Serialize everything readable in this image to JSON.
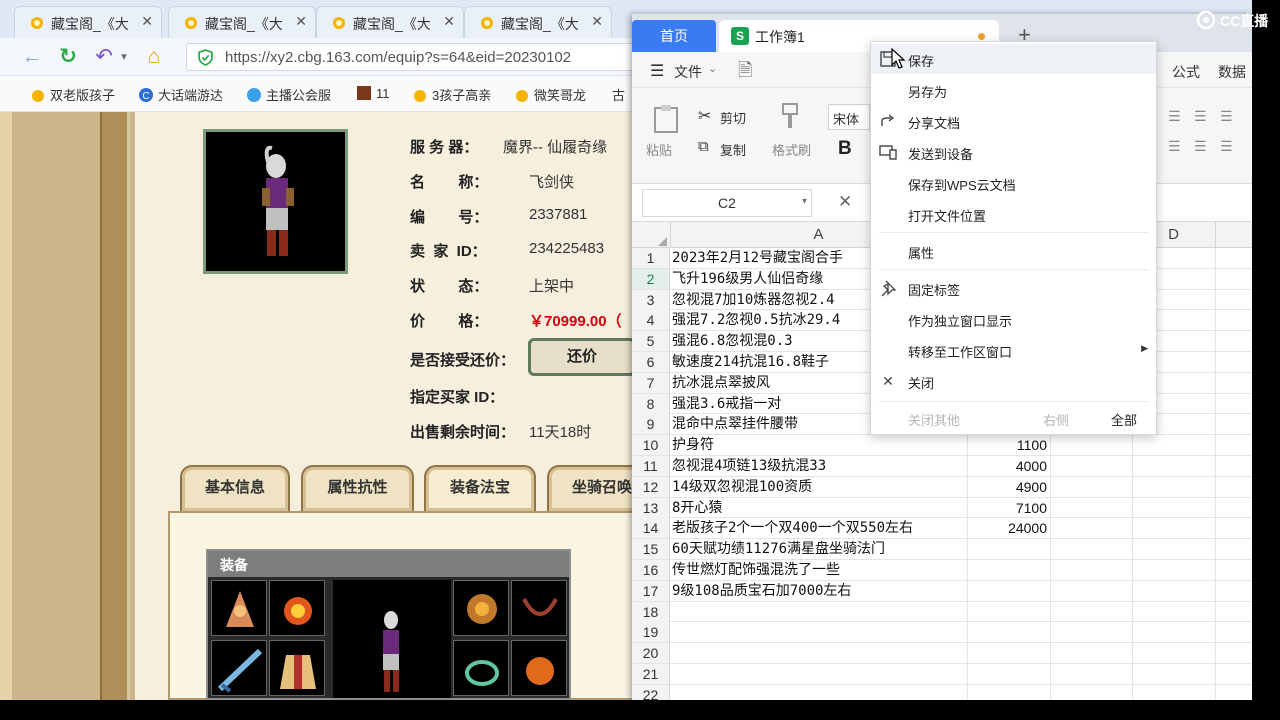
{
  "browser": {
    "tabs": [
      {
        "title": "藏宝阁_《大"
      },
      {
        "title": "藏宝阁_《大"
      },
      {
        "title": "藏宝阁_《大"
      },
      {
        "title": "藏宝阁_《大"
      }
    ],
    "url": "https://xy2.cbg.163.com/equip?s=64&eid=20230102",
    "bookmarks": [
      "双老版孩子",
      "大话端游达",
      "主播公会服",
      "11",
      "3孩子高亲",
      "微笑哥龙",
      "古"
    ]
  },
  "listing": {
    "labels": {
      "server": "服 务 器：",
      "name": "名        称：",
      "id": "编        号：",
      "seller": "卖  家  ID：",
      "status": "状        态：",
      "price": "价        格：",
      "counter_offer": "是否接受还价：",
      "buyer_id": "指定买家 ID：",
      "remaining": "出售剩余时间："
    },
    "server": "魔界-- 仙履奇缘",
    "name": "飞剑侠",
    "id": "2337881",
    "seller_id": "234225483",
    "status": "上架中",
    "price": "￥70999.00（",
    "remaining_time": "11天18时",
    "counter_button": "还价",
    "tabs": [
      "基本信息",
      "属性抗性",
      "装备法宝",
      "坐骑召唤"
    ],
    "equip_title": "装备"
  },
  "wps": {
    "home_tab": "首页",
    "doc_tab": "工作簿1",
    "doc_icon": "S",
    "menu": {
      "file": "文件",
      "formula": "公式",
      "data": "数据"
    },
    "ribbon": {
      "paste": "粘贴",
      "cut": "剪切",
      "copy": "复制",
      "format_painter": "格式刷",
      "font": "宋体",
      "bold": "B"
    },
    "name_box": "C2",
    "columns": [
      "A",
      "D"
    ],
    "rows": [
      {
        "n": "1",
        "a": "2023年2月12号藏宝阁合手",
        "b": ""
      },
      {
        "n": "2",
        "a": "飞升196级男人仙侣奇缘",
        "b": ""
      },
      {
        "n": "3",
        "a": "忽视混7加10炼器忽视2.4",
        "b": ""
      },
      {
        "n": "4",
        "a": "强混7.2忽视0.5抗冰29.4",
        "b": ""
      },
      {
        "n": "5",
        "a": "强混6.8忽视混0.3",
        "b": ""
      },
      {
        "n": "6",
        "a": "敏速度214抗混16.8鞋子",
        "b": ""
      },
      {
        "n": "7",
        "a": "抗冰混点翠披风",
        "b": ""
      },
      {
        "n": "8",
        "a": "强混3.6戒指一对",
        "b": ""
      },
      {
        "n": "9",
        "a": "混命中点翠挂件腰带",
        "b": ""
      },
      {
        "n": "10",
        "a": "护身符",
        "b": "1100"
      },
      {
        "n": "11",
        "a": "忽视混4项链13级抗混33",
        "b": "4000"
      },
      {
        "n": "12",
        "a": "14级双忽视混100资质",
        "b": "4900"
      },
      {
        "n": "13",
        "a": "8开心猿",
        "b": "7100"
      },
      {
        "n": "14",
        "a": "老版孩子2个一个双400一个双550左右",
        "b": "24000"
      },
      {
        "n": "15",
        "a": "60天赋功绩11276满星盘坐骑法门",
        "b": ""
      },
      {
        "n": "16",
        "a": "传世燃灯配饰强混洗了一些",
        "b": ""
      },
      {
        "n": "17",
        "a": "9级108品质宝石加7000左右",
        "b": ""
      },
      {
        "n": "18",
        "a": "",
        "b": ""
      },
      {
        "n": "19",
        "a": "",
        "b": ""
      },
      {
        "n": "20",
        "a": "",
        "b": ""
      },
      {
        "n": "21",
        "a": "",
        "b": ""
      },
      {
        "n": "22",
        "a": "",
        "b": ""
      }
    ]
  },
  "context_menu": {
    "items": [
      {
        "label": "保存",
        "icon": "save-icon"
      },
      {
        "label": "另存为",
        "icon": ""
      },
      {
        "label": "分享文档",
        "icon": "share-icon"
      },
      {
        "label": "发送到设备",
        "icon": "device-icon"
      },
      {
        "label": "保存到WPS云文档",
        "icon": ""
      },
      {
        "label": "打开文件位置",
        "icon": ""
      },
      {
        "label": "属性",
        "icon": ""
      },
      {
        "label": "固定标签",
        "icon": "pin-icon"
      },
      {
        "label": "作为独立窗口显示",
        "icon": ""
      },
      {
        "label": "转移至工作区窗口",
        "icon": ""
      },
      {
        "label": "关闭",
        "icon": "close-icon"
      }
    ],
    "footer": {
      "close_others": "关闭其他",
      "right": "右侧",
      "all": "全部"
    }
  },
  "overlay": {
    "logo_text": "CC直播"
  }
}
